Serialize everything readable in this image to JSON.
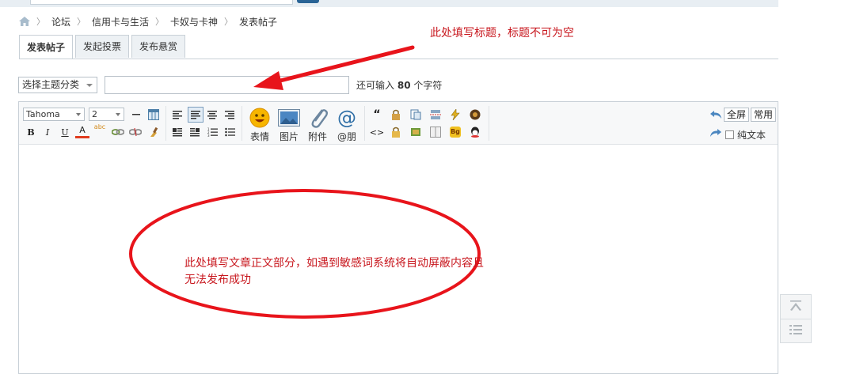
{
  "breadcrumb": {
    "items": [
      "论坛",
      "信用卡与生活",
      "卡奴与卡神",
      "发表帖子"
    ]
  },
  "tabs": [
    {
      "label": "发表帖子",
      "active": true
    },
    {
      "label": "发起投票",
      "active": false
    },
    {
      "label": "发布悬赏",
      "active": false
    }
  ],
  "subject": {
    "category_placeholder": "选择主题分类",
    "title_value": "",
    "hint_prefix": "还可输入",
    "hint_count": "80",
    "hint_suffix": "个字符"
  },
  "toolbar": {
    "font_family": "Tahoma",
    "font_size": "2",
    "emoji_label": "表情",
    "image_label": "图片",
    "attach_label": "附件",
    "at_label": "@朋",
    "fullscreen_label": "全屏",
    "common_label": "常用",
    "plain_text_label": "纯文本",
    "format_labels": {
      "bold": "B",
      "italic": "I",
      "underline": "U",
      "color": "A",
      "spell": "abc",
      "quote": "“",
      "code": "<>",
      "bg": "Bg"
    }
  },
  "annotations": {
    "title_note": "此处填写标题，标题不可为空",
    "body_note": "此处填写文章正文部分，如遇到敏感词系统将自动屏蔽内容且无法发布成功"
  },
  "colors": {
    "annotation_red": "#c8171e",
    "border": "#c8d0d7",
    "toolbar_bg": "#f7f8f9"
  }
}
